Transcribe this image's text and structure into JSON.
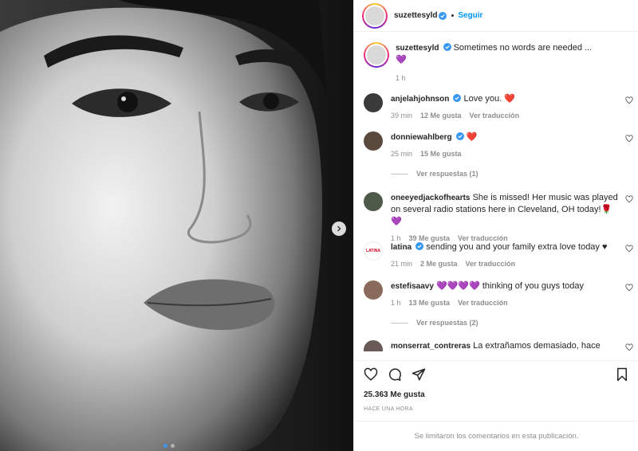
{
  "post": {
    "username": "suzettesyld",
    "follow_label": "Seguir",
    "caption_text": "Sometimes no words are needed ...",
    "caption_emoji": "💜",
    "caption_time": "1 h",
    "likes_text": "25.363 Me gusta",
    "timestamp": "HACE UNA HORA",
    "comments_disabled": "Se limitaron los comentarios en esta publicación."
  },
  "comments": [
    {
      "username": "anjelahjohnson",
      "verified": true,
      "text": "Love you. ",
      "emoji": "❤️",
      "time": "39 min",
      "likes": "12 Me gusta",
      "translate": "Ver traducción",
      "avatar_color": "#3a3a3a"
    },
    {
      "username": "donniewahlberg",
      "verified": true,
      "text": "",
      "emoji": "❤️",
      "time": "25 min",
      "likes": "15 Me gusta",
      "translate": "",
      "replies": "Ver respuestas (1)",
      "avatar_color": "#5a4a3e"
    },
    {
      "username": "oneeyedjackofhearts",
      "verified": false,
      "text": "She is missed! Her music was played on several radio stations here in Cleveland, OH today!",
      "emoji": "🌹💜",
      "time": "1 h",
      "likes": "39 Me gusta",
      "translate": "Ver traducción",
      "avatar_color": "#4d5a4a"
    },
    {
      "username": "latina",
      "verified": true,
      "text": "sending you and your family extra love today ",
      "emoji": "♥",
      "time": "21 min",
      "likes": "2 Me gusta",
      "translate": "Ver traducción",
      "avatar_text": "LATINA",
      "avatar_color": "#ffffff"
    },
    {
      "username": "estefisaavy",
      "verified": false,
      "text": "💜💜💜💜 thinking of you guys today",
      "emoji": "",
      "time": "1 h",
      "likes": "13 Me gusta",
      "translate": "Ver traducción",
      "replies": "Ver respuestas (2)",
      "avatar_color": "#8a6a5a"
    },
    {
      "username": "monserrat_contreras",
      "verified": false,
      "text": "La extrañamos demasiado, hace tanta falta aquí ",
      "emoji": "❤️",
      "avatar_color": "#6a5a55"
    }
  ],
  "icons": {
    "like": "heart-icon",
    "comment": "comment-icon",
    "share": "share-icon",
    "save": "bookmark-icon",
    "next": "chevron-right-icon",
    "verified": "verified-badge-icon"
  },
  "colors": {
    "accent": "#0095f6",
    "verified": "#3897f0",
    "text": "#262626",
    "muted": "#8e8e8e"
  }
}
